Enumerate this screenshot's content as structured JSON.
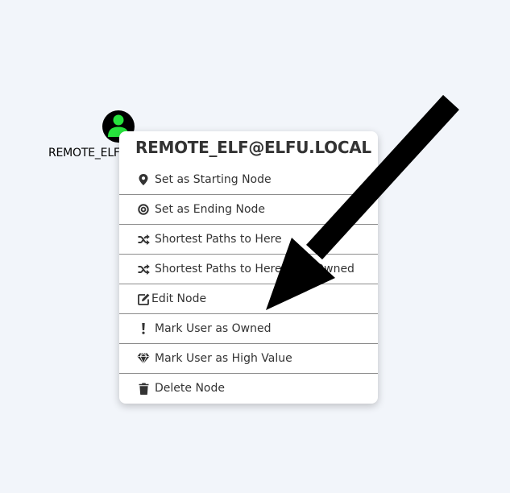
{
  "node": {
    "label": "REMOTE_ELF@ELFU.LOCAL",
    "icon": "user-icon",
    "icon_color": "#27e43d"
  },
  "context_menu": {
    "title": "REMOTE_ELF@ELFU.LOCAL",
    "items": [
      {
        "label": "Set as Starting Node",
        "icon": "map-marker-icon"
      },
      {
        "label": "Set as Ending Node",
        "icon": "bullseye-icon"
      },
      {
        "label": "Shortest Paths to Here",
        "icon": "random-icon"
      },
      {
        "label": "Shortest Paths to Here from Owned",
        "icon": "random-icon"
      },
      {
        "label": "Edit Node",
        "icon": "edit-icon"
      },
      {
        "label": "Mark User as Owned",
        "icon": "exclamation-icon"
      },
      {
        "label": "Mark User as High Value",
        "icon": "gem-icon"
      },
      {
        "label": "Delete Node",
        "icon": "trash-icon"
      }
    ]
  },
  "colors": {
    "background": "#f2f5fa",
    "menu_text": "#333333",
    "arrow": "#000000"
  }
}
